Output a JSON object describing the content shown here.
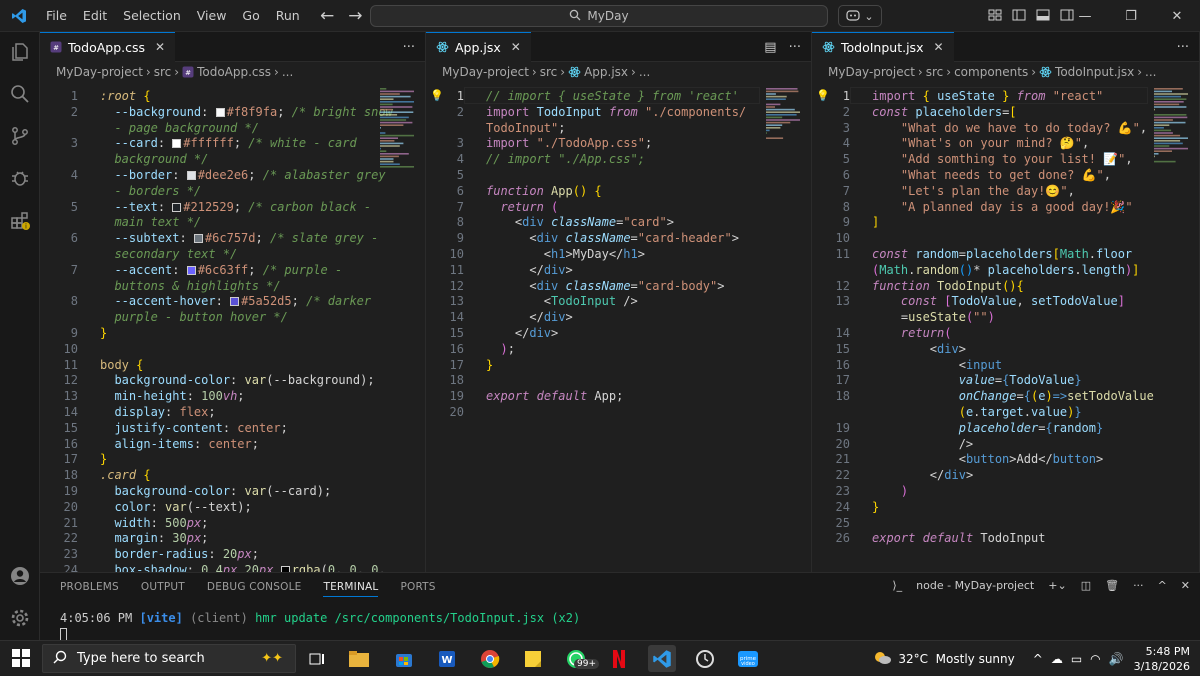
{
  "titlebar": {
    "menus": [
      "File",
      "Edit",
      "Selection",
      "View",
      "Go",
      "Run"
    ],
    "search_text": "MyDay",
    "more": "···"
  },
  "panes": [
    {
      "tab": "TodoApp.css",
      "breadcrumb": [
        "MyDay-project",
        "src",
        "TodoApp.css",
        "..."
      ],
      "lines": [
        {
          "n": "1",
          "html": "<span class='sel' style='font-style:italic'>:root</span> <span class='br2'>{</span>"
        },
        {
          "n": "2",
          "html": "  <span class='vr'>--background</span><span class='pu'>: </span><span class='sw' style='background:#f8f9fa'></span><span class='st'>#f8f9fa</span><span class='pu'>; </span><span class='cm'>/* bright snow</span>"
        },
        {
          "n": "",
          "html": "  <span class='cm'>- page background */</span>"
        },
        {
          "n": "3",
          "html": "  <span class='vr'>--card</span><span class='pu'>: </span><span class='sw' style='background:#ffffff'></span><span class='st'>#ffffff</span><span class='pu'>; </span><span class='cm'>/* white - card</span>"
        },
        {
          "n": "",
          "html": "  <span class='cm'>background */</span>"
        },
        {
          "n": "4",
          "html": "  <span class='vr'>--border</span><span class='pu'>: </span><span class='sw' style='background:#dee2e6'></span><span class='st'>#dee2e6</span><span class='pu'>; </span><span class='cm'>/* alabaster grey</span>"
        },
        {
          "n": "",
          "html": "  <span class='cm'>- borders */</span>"
        },
        {
          "n": "5",
          "html": "  <span class='vr'>--text</span><span class='pu'>: </span><span class='sw' style='background:#212529'></span><span class='st'>#212529</span><span class='pu'>; </span><span class='cm'>/* carbon black -</span>"
        },
        {
          "n": "",
          "html": "  <span class='cm'>main text */</span>"
        },
        {
          "n": "6",
          "html": "  <span class='vr'>--subtext</span><span class='pu'>: </span><span class='sw' style='background:#6c757d'></span><span class='st'>#6c757d</span><span class='pu'>; </span><span class='cm'>/* slate grey -</span>"
        },
        {
          "n": "",
          "html": "  <span class='cm'>secondary text */</span>"
        },
        {
          "n": "7",
          "html": "  <span class='vr'>--accent</span><span class='pu'>: </span><span class='sw' style='background:#6c63ff'></span><span class='st'>#6c63ff</span><span class='pu'>; </span><span class='cm'>/* purple -</span>"
        },
        {
          "n": "",
          "html": "  <span class='cm'>buttons &amp; highlights */</span>"
        },
        {
          "n": "8",
          "html": "  <span class='vr'>--accent-hover</span><span class='pu'>: </span><span class='sw' style='background:#5a52d5'></span><span class='st'>#5a52d5</span><span class='pu'>; </span><span class='cm'>/* darker</span>"
        },
        {
          "n": "",
          "html": "  <span class='cm'>purple - button hover */</span>"
        },
        {
          "n": "9",
          "html": "<span class='br2'>}</span>"
        },
        {
          "n": "10",
          "html": ""
        },
        {
          "n": "11",
          "html": "<span class='sel'>body</span> <span class='br2'>{</span>"
        },
        {
          "n": "12",
          "html": "  <span class='vr'>background-color</span><span class='pu'>: </span><span class='fn'>var</span><span class='pu'>(--background);</span>"
        },
        {
          "n": "13",
          "html": "  <span class='vr'>min-height</span><span class='pu'>: </span><span class='num'>100</span><span class='kw'>vh</span><span class='pu'>;</span>"
        },
        {
          "n": "14",
          "html": "  <span class='vr'>display</span><span class='pu'>: </span><span class='st'>flex</span><span class='pu'>;</span>"
        },
        {
          "n": "15",
          "html": "  <span class='vr'>justify-content</span><span class='pu'>: </span><span class='st'>center</span><span class='pu'>;</span>"
        },
        {
          "n": "16",
          "html": "  <span class='vr'>align-items</span><span class='pu'>: </span><span class='st'>center</span><span class='pu'>;</span>"
        },
        {
          "n": "17",
          "html": "<span class='br2'>}</span>"
        },
        {
          "n": "18",
          "html": "<span class='sel' style='font-style:italic'>.card</span> <span class='br2'>{</span>"
        },
        {
          "n": "19",
          "html": "  <span class='vr'>background-color</span><span class='pu'>: </span><span class='fn'>var</span><span class='pu'>(--card);</span>"
        },
        {
          "n": "20",
          "html": "  <span class='vr'>color</span><span class='pu'>: </span><span class='fn'>var</span><span class='pu'>(--text);</span>"
        },
        {
          "n": "21",
          "html": "  <span class='vr'>width</span><span class='pu'>: </span><span class='num'>500</span><span class='kw'>px</span><span class='pu'>;</span>"
        },
        {
          "n": "22",
          "html": "  <span class='vr'>margin</span><span class='pu'>: </span><span class='num'>30</span><span class='kw'>px</span><span class='pu'>;</span>"
        },
        {
          "n": "23",
          "html": "  <span class='vr'>border-radius</span><span class='pu'>: </span><span class='num'>20</span><span class='kw'>px</span><span class='pu'>;</span>"
        },
        {
          "n": "24",
          "html": "  <span class='vr'>box-shadow</span><span class='pu'>: </span><span class='num'>0</span> <span class='num'>4</span><span class='kw'>px</span> <span class='num'>20</span><span class='kw'>px</span> <span class='sw' style='background:#000'></span><span class='fn'>rgba</span><span class='pu'>(</span><span class='num'>0</span><span class='pu'>, </span><span class='num'>0</span><span class='pu'>, </span><span class='num'>0</span><span class='pu'>,</span>"
        }
      ]
    },
    {
      "tab": "App.jsx",
      "breadcrumb": [
        "MyDay-project",
        "src",
        "App.jsx",
        "..."
      ],
      "lines": [
        {
          "n": "1",
          "html": "<span class='cm'>// import { useState } from 'react'</span>",
          "cur": true
        },
        {
          "n": "2",
          "html": "<span class='kw2'>import</span> <span class='vr'>TodoInput</span> <span class='kw'>from</span> <span class='st'>\"./components/</span>"
        },
        {
          "n": "",
          "html": "<span class='st'>TodoInput\"</span><span class='pu'>;</span>"
        },
        {
          "n": "3",
          "html": "<span class='kw2'>import</span> <span class='st'>\"./TodoApp.css\"</span><span class='pu'>;</span>"
        },
        {
          "n": "4",
          "html": "<span class='cm'>// import \"./App.css\";</span>"
        },
        {
          "n": "5",
          "html": ""
        },
        {
          "n": "6",
          "html": "<span class='kw'>function</span> <span class='fn'>App</span><span class='br2'>()</span> <span class='br2'>{</span>"
        },
        {
          "n": "7",
          "html": "  <span class='kw'>return</span> <span class='br'>(</span>"
        },
        {
          "n": "8",
          "html": "    <span class='pu'>&lt;</span><span class='tg'>div</span> <span class='at'>className</span><span class='pu'>=</span><span class='st'>\"card\"</span><span class='pu'>&gt;</span>"
        },
        {
          "n": "9",
          "html": "      <span class='pu'>&lt;</span><span class='tg'>div</span> <span class='at'>className</span><span class='pu'>=</span><span class='st'>\"card-header\"</span><span class='pu'>&gt;</span>"
        },
        {
          "n": "10",
          "html": "        <span class='pu'>&lt;</span><span class='tg'>h1</span><span class='pu'>&gt;</span><span class='pu'>MyDay</span><span class='pu'>&lt;/</span><span class='tg'>h1</span><span class='pu'>&gt;</span>"
        },
        {
          "n": "11",
          "html": "      <span class='pu'>&lt;/</span><span class='tg'>div</span><span class='pu'>&gt;</span>"
        },
        {
          "n": "12",
          "html": "      <span class='pu'>&lt;</span><span class='tg'>div</span> <span class='at'>className</span><span class='pu'>=</span><span class='st'>\"card-body\"</span><span class='pu'>&gt;</span>"
        },
        {
          "n": "13",
          "html": "        <span class='pu'>&lt;</span><span class='cls'>TodoInput</span> <span class='pu'>/&gt;</span>"
        },
        {
          "n": "14",
          "html": "      <span class='pu'>&lt;/</span><span class='tg'>div</span><span class='pu'>&gt;</span>"
        },
        {
          "n": "15",
          "html": "    <span class='pu'>&lt;/</span><span class='tg'>div</span><span class='pu'>&gt;</span>"
        },
        {
          "n": "16",
          "html": "  <span class='br'>)</span><span class='pu'>;</span>"
        },
        {
          "n": "17",
          "html": "<span class='br2'>}</span>"
        },
        {
          "n": "18",
          "html": ""
        },
        {
          "n": "19",
          "html": "<span class='kw'>export</span> <span class='kw'>default</span> <span class='pu'>App;</span>"
        },
        {
          "n": "20",
          "html": ""
        }
      ]
    },
    {
      "tab": "TodoInput.jsx",
      "breadcrumb": [
        "MyDay-project",
        "src",
        "components",
        "TodoInput.jsx",
        "..."
      ],
      "lines": [
        {
          "n": "1",
          "html": "<span class='kw2'>import</span> <span class='br2'>{</span> <span class='vr'>useState</span> <span class='br2'>}</span> <span class='kw'>from</span> <span class='st'>\"react\"</span>",
          "cur": true
        },
        {
          "n": "2",
          "html": "<span class='kw'>const</span> <span class='vr'>placeholders</span><span class='pu'>=</span><span class='br2'>[</span>"
        },
        {
          "n": "3",
          "html": "    <span class='st'>\"What do we have to do today? 💪\"</span><span class='pu'>,</span>"
        },
        {
          "n": "4",
          "html": "    <span class='st'>\"What's on your mind? 🤔\"</span><span class='pu'>,</span>"
        },
        {
          "n": "5",
          "html": "    <span class='st'>\"Add somthing to your list! 📝\"</span><span class='pu'>,</span>"
        },
        {
          "n": "6",
          "html": "    <span class='st'>\"What needs to get done? 💪\"</span><span class='pu'>,</span>"
        },
        {
          "n": "7",
          "html": "    <span class='st'>\"Let's plan the day!😊\"</span><span class='pu'>,</span>"
        },
        {
          "n": "8",
          "html": "    <span class='st'>\"A planned day is a good day!🎉\"</span>"
        },
        {
          "n": "9",
          "html": "<span class='br2'>]</span>"
        },
        {
          "n": "10",
          "html": ""
        },
        {
          "n": "11",
          "html": "<span class='kw'>const</span> <span class='vr'>random</span><span class='pu'>=</span><span class='vr'>placeholders</span><span class='br2'>[</span><span class='cls'>Math</span><span class='pu'>.</span><span class='vr'>floor</span>"
        },
        {
          "n": "",
          "html": "<span class='br'>(</span><span class='cls'>Math</span><span class='pu'>.</span><span class='fn'>random</span><span class='br3'>()</span><span class='pu'>* </span><span class='vr'>placeholders</span><span class='pu'>.</span><span class='vr'>length</span><span class='br'>)</span><span class='br2'>]</span>"
        },
        {
          "n": "12",
          "html": "<span class='kw'>function</span> <span class='fn'>TodoInput</span><span class='br2'>()</span><span class='br2'>{</span>"
        },
        {
          "n": "13",
          "html": "    <span class='kw'>const</span> <span class='br'>[</span><span class='vr'>TodoValue</span><span class='pu'>, </span><span class='vr'>setTodoValue</span><span class='br'>]</span>"
        },
        {
          "n": "",
          "html": "    <span class='pu'>=</span><span class='fn'>useState</span><span class='br'>(</span><span class='st'>\"\"</span><span class='br'>)</span>"
        },
        {
          "n": "14",
          "html": "    <span class='kw'>return</span><span class='br'>(</span>"
        },
        {
          "n": "15",
          "html": "        <span class='pu'>&lt;</span><span class='tg'>div</span><span class='pu'>&gt;</span>"
        },
        {
          "n": "16",
          "html": "            <span class='pu'>&lt;</span><span class='tg'>input</span>"
        },
        {
          "n": "17",
          "html": "            <span class='at'>value</span><span class='pu'>=</span><span class='tg'>{</span><span class='vr'>TodoValue</span><span class='tg'>}</span>"
        },
        {
          "n": "18",
          "html": "            <span class='at'>onChange</span><span class='pu'>=</span><span class='tg'>{</span><span class='br2'>(</span><span class='vr'>e</span><span class='br2'>)</span><span class='tg'>=&gt;</span><span class='fn'>setTodoValue</span>"
        },
        {
          "n": "",
          "html": "            <span class='br2'>(</span><span class='vr'>e</span><span class='pu'>.</span><span class='vr'>target</span><span class='pu'>.</span><span class='vr'>value</span><span class='br2'>)</span><span class='tg'>}</span>"
        },
        {
          "n": "19",
          "html": "            <span class='at'>placeholder</span><span class='pu'>=</span><span class='tg'>{</span><span class='vr'>random</span><span class='tg'>}</span>"
        },
        {
          "n": "20",
          "html": "            <span class='pu'>/&gt;</span>"
        },
        {
          "n": "21",
          "html": "            <span class='pu'>&lt;</span><span class='tg'>button</span><span class='pu'>&gt;</span><span class='pu'>Add</span><span class='pu'>&lt;/</span><span class='tg'>button</span><span class='pu'>&gt;</span>"
        },
        {
          "n": "22",
          "html": "        <span class='pu'>&lt;/</span><span class='tg'>div</span><span class='pu'>&gt;</span>"
        },
        {
          "n": "23",
          "html": "    <span class='br'>)</span>"
        },
        {
          "n": "24",
          "html": "<span class='br2'>}</span>"
        },
        {
          "n": "25",
          "html": ""
        },
        {
          "n": "26",
          "html": "<span class='kw'>export</span> <span class='kw'>default</span> <span class='pu'>TodoInput</span>"
        }
      ]
    }
  ],
  "panel": {
    "tabs": [
      "PROBLEMS",
      "OUTPUT",
      "DEBUG CONSOLE",
      "TERMINAL",
      "PORTS"
    ],
    "active_tab": "TERMINAL",
    "terminal_name": "node - MyDay-project",
    "terminal_time": "4:05:06 PM",
    "terminal_tag": "[vite]",
    "terminal_msg": "(client)",
    "terminal_text": "hmr update /src/components/TodoInput.jsx (x2)"
  },
  "taskbar": {
    "search_placeholder": "Type here to search",
    "whatsapp_badge": "99+",
    "weather": "32°C  Mostly sunny",
    "time": "5:48 PM",
    "date": "3/18/2026"
  }
}
